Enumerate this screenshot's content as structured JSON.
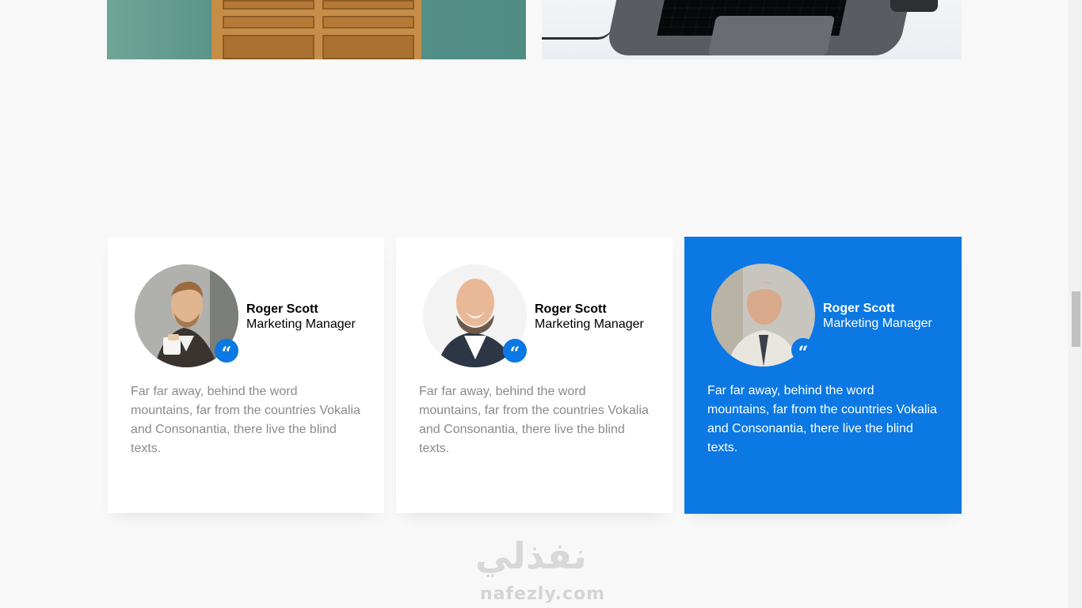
{
  "hero_images": [
    {
      "name": "office-drawers-photo",
      "color": "#5a958b"
    },
    {
      "name": "laptop-photo",
      "color": "#eceef1"
    }
  ],
  "testimonials": [
    {
      "name": "Roger Scott",
      "role": "Marketing Manager",
      "text": "Far far away, behind the word mountains, far from the countries Vokalia and Consonantia, there live the blind texts.",
      "active": false
    },
    {
      "name": "Roger Scott",
      "role": "Marketing Manager",
      "text": "Far far away, behind the word mountains, far from the countries Vokalia and Consonantia, there live the blind texts.",
      "active": false
    },
    {
      "name": "Roger Scott",
      "role": "Marketing Manager",
      "text": "Far far away, behind the word mountains, far from the countries Vokalia and Consonantia, there live the blind texts.",
      "active": true
    }
  ],
  "quote_icon": "quote-icon",
  "accent_color": "#0b78e3",
  "watermark": {
    "arabic": "نفذلي",
    "latin": "nafezly.com"
  }
}
